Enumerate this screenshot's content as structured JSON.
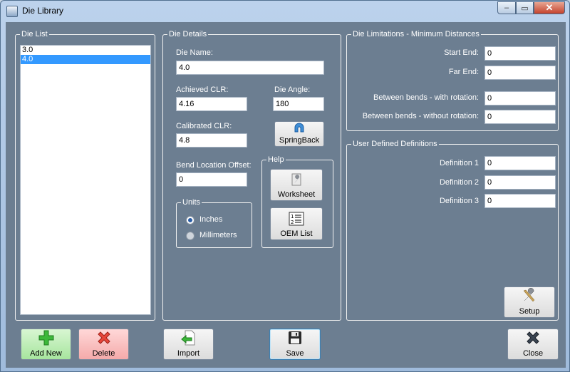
{
  "window": {
    "title": "Die Library",
    "controls": {
      "minimize": "‒",
      "maximize": "▭",
      "close": "✕"
    }
  },
  "die_list": {
    "group_label": "Die List",
    "items": [
      "3.0",
      "4.0"
    ],
    "selected": "4.0"
  },
  "die_details": {
    "group_label": "Die Details",
    "die_name_label": "Die Name:",
    "die_name_value": "4.0",
    "achieved_clr_label": "Achieved CLR:",
    "achieved_clr_value": "4.16",
    "die_angle_label": "Die Angle:",
    "die_angle_value": "180",
    "calibrated_clr_label": "Calibrated CLR:",
    "calibrated_clr_value": "4.8",
    "springback_label": "SpringBack",
    "bend_offset_label": "Bend Location Offset:",
    "bend_offset_value": "0",
    "units": {
      "group_label": "Units",
      "inches_label": "Inches",
      "millimeters_label": "Millimeters",
      "selected": "Inches"
    },
    "help": {
      "group_label": "Help",
      "worksheet_label": "Worksheet",
      "oem_list_label": "OEM List"
    }
  },
  "limitations": {
    "group_label": "Die Limitations - Minimum Distances",
    "start_end_label": "Start End:",
    "start_end_value": "0",
    "far_end_label": "Far End:",
    "far_end_value": "0",
    "with_rotation_label": "Between bends - with rotation:",
    "with_rotation_value": "0",
    "without_rotation_label": "Between bends - without rotation:",
    "without_rotation_value": "0"
  },
  "user_defined": {
    "group_label": "User Defined Definitions",
    "def1_label": "Definition 1",
    "def1_value": "0",
    "def2_label": "Definition 2",
    "def2_value": "0",
    "def3_label": "Definition 3",
    "def3_value": "0",
    "setup_label": "Setup"
  },
  "buttons": {
    "add_new": "Add New",
    "delete": "Delete",
    "import": "Import",
    "save": "Save",
    "close": "Close"
  },
  "icons": {
    "add": "plus-icon",
    "delete": "x-icon",
    "import": "import-arrow-icon",
    "save": "floppy-disk-icon",
    "close": "close-x-icon",
    "setup": "tools-icon",
    "worksheet": "wrench-icon",
    "oem_list": "numbered-list-icon",
    "springback": "springback-icon"
  }
}
